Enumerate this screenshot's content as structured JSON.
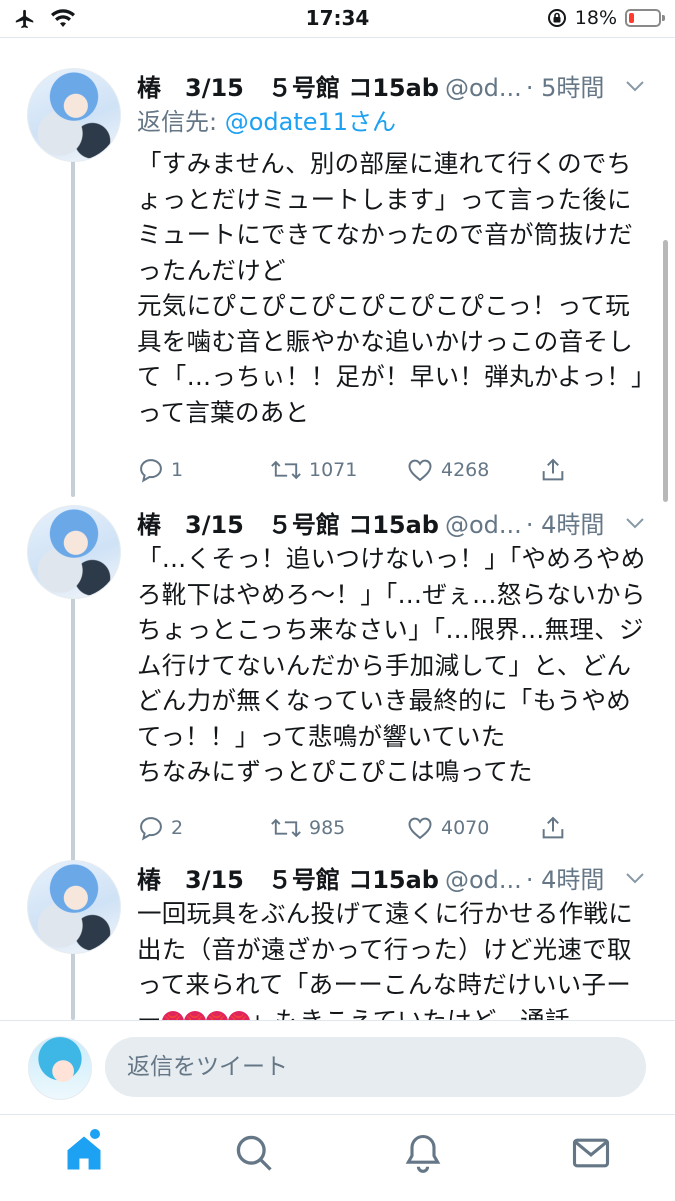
{
  "status_bar": {
    "time": "17:34",
    "battery_percent": "18%",
    "battery_level": 0.18
  },
  "tweets": [
    {
      "author": "椿　3/15　５号館 コ15ab",
      "handle": "@od...",
      "time": "· 5時間",
      "reply_to_label": "返信先: ",
      "reply_to_user": "@odate11さん",
      "text": "「すみません、別の部屋に連れて行くのでちょっとだけミュートします」って言った後にミュートにできてなかったので音が筒抜けだったんだけど\n元気にぴこぴこぴこぴこぴこぴこっ！って玩具を噛む音と賑やかな追いかけっこの音そして「…っちぃ！！足が！早い！弾丸かよっ！」って言葉のあと",
      "replies": "1",
      "retweets": "1071",
      "likes": "4268"
    },
    {
      "author": "椿　3/15　５号館 コ15ab",
      "handle": "@od...",
      "time": "· 4時間",
      "text": "「…くそっ！追いつけないっ！」「やめろやめろ靴下はやめろ〜！」「…ぜぇ…怒らないからちょっとこっち来なさい」「…限界…無理、ジム行けてないんだから手加減して」と、どんどん力が無くなっていき最終的に「もうやめてっ！！」って悲鳴が響いていた\nちなみにずっとぴこぴこは鳴ってた",
      "replies": "2",
      "retweets": "985",
      "likes": "4070"
    },
    {
      "author": "椿　3/15　５号館 コ15ab",
      "handle": "@od...",
      "time": "· 4時間",
      "text_before": "一回玩具をぶん投げて遠くに行かせる作戦に出た（音が遠ざかって行った）けど光速で取って来られて「あーーこんな時だけいい子ーー",
      "emoji": "💢",
      "text_after": "」もきこえていたけど、通話"
    }
  ],
  "reply_bar": {
    "placeholder": "返信をツイート"
  },
  "tab_bar": {
    "active": "home"
  },
  "colors": {
    "accent": "#1da1f2",
    "secondary_text": "#657786",
    "thread_line": "#c4cfd6"
  }
}
